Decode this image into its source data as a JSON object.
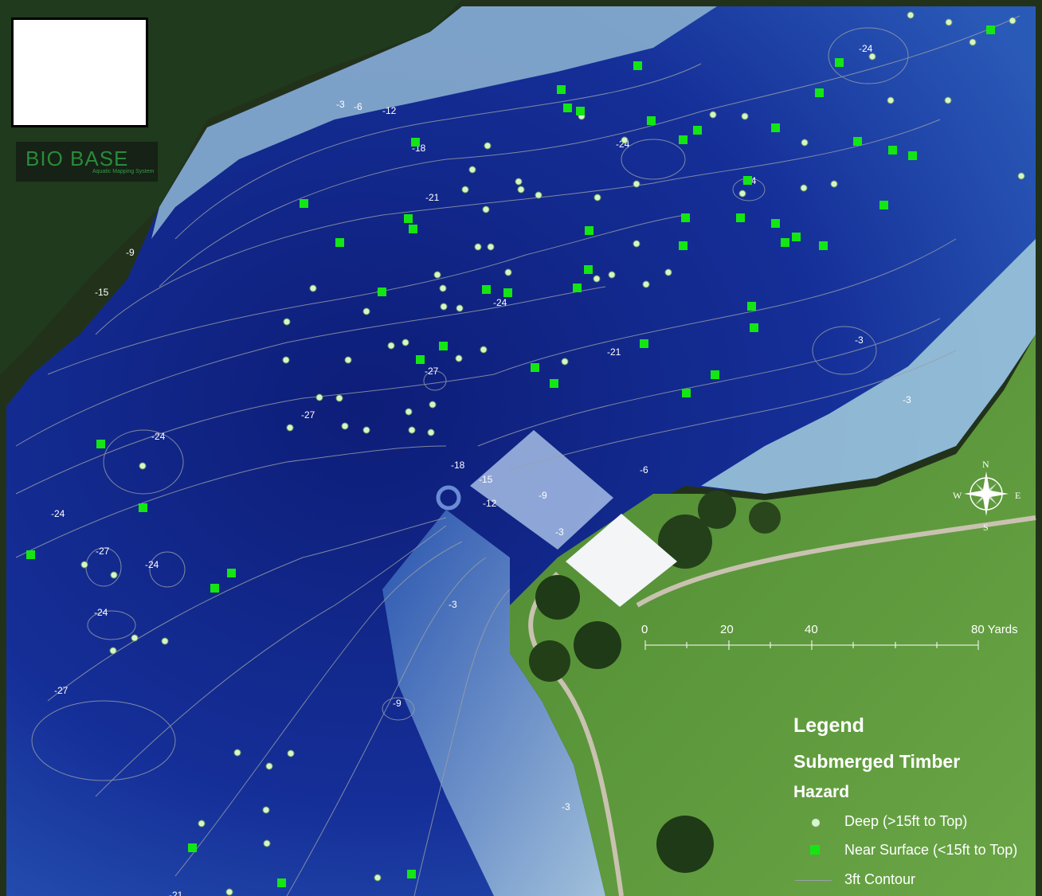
{
  "logo": {
    "text": "BIO BASE",
    "subtitle": "Aquatic Mapping System"
  },
  "colors": {
    "deep_water": "#0c1f78",
    "mid_water": "#1a3fa8",
    "shallow_water": "#9fc4dc",
    "land_grass": "#5f9a3c",
    "deep_marker": "#d8f5c8",
    "near_surface_marker": "#14e614",
    "contour": "#9aa0a8"
  },
  "contour_labels": [
    "-3",
    "-6",
    "-12",
    "-18",
    "-21",
    "-24",
    "-24",
    "-24",
    "-21",
    "-24",
    "-27",
    "-27",
    "-24",
    "-24",
    "-27",
    "-24",
    "-24",
    "-27",
    "-9",
    "-15",
    "-18",
    "-15",
    "-12",
    "-9",
    "-3",
    "-6",
    "-21",
    "-3",
    "-3",
    "-3",
    "-9",
    "-3",
    "-24",
    "-21"
  ],
  "scale_bar": {
    "labels": [
      "0",
      "20",
      "40",
      "80 Yards"
    ]
  },
  "compass": {
    "n": "N",
    "s": "S",
    "e": "E",
    "w": "W"
  },
  "legend": {
    "title": "Legend",
    "heading1": "Submerged Timber",
    "heading2": "Hazard",
    "items": [
      {
        "label": "Deep (>15ft to Top)",
        "symbol": "light-green-circle"
      },
      {
        "label": "Near Surface (<15ft to Top)",
        "symbol": "green-square"
      },
      {
        "label": "3ft Contour",
        "symbol": "gray-line"
      }
    ]
  }
}
